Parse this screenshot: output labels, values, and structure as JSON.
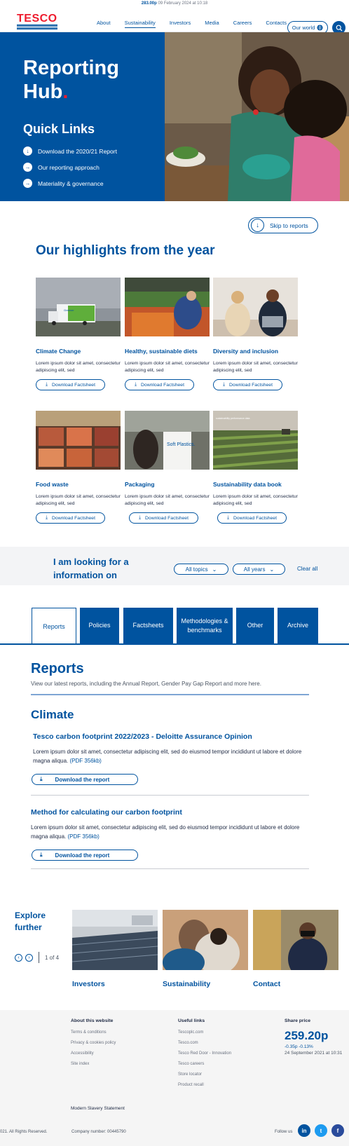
{
  "ticker": {
    "price": "283.00p",
    "date": "09 February 2024 at 10:18"
  },
  "header": {
    "logo": "TESCO",
    "nav": [
      "About",
      "Sustainability",
      "Investors",
      "Media",
      "Careers",
      "Contacts"
    ],
    "active_nav": "Sustainability",
    "our_world": "Our world"
  },
  "hero": {
    "title_line1": "Reporting",
    "title_line2": "Hub",
    "quick_links_title": "Quick Links",
    "quick_links": [
      "Download the 2020/21 Report",
      "Our reporting approach",
      "Materiality & governance"
    ]
  },
  "skip_label": "Skip to reports",
  "highlights": {
    "title": "Our highlights from the year",
    "cards": [
      {
        "title": "Climate Change",
        "desc": "Lorem ipsum dolor sit amet, consectetur adipiscing elit, sed",
        "button": "Download Factsheet"
      },
      {
        "title": "Healthy, sustainable diets",
        "desc": "Lorem ipsum dolor sit amet, consectetur adipiscing elit, sed",
        "button": "Download Factsheet"
      },
      {
        "title": "Diversity and inclusion",
        "desc": "Lorem ipsum dolor sit amet, consectetur adipiscing elit, sed",
        "button": "Download Factsheet"
      },
      {
        "title": "Food waste",
        "desc": "Lorem ipsum dolor sit amet, consectetur adipiscing elit, sed",
        "button": "Download Factsheet"
      },
      {
        "title": "Packaging",
        "desc": "Lorem ipsum dolor sit amet, consectetur adipiscing elit, sed",
        "button": "Download Factsheet"
      },
      {
        "title": "Sustainability data book",
        "desc": "Lorem ipsum dolor sit amet, consectetur adipiscing elit, sed",
        "button": "Download Factsheet"
      }
    ],
    "image_texts": {
      "truck": "Greener",
      "bag": "Soft Plastics.",
      "field": "sustainability performance data"
    }
  },
  "filter": {
    "label": "I am looking for a information on",
    "topics": "All topics",
    "years": "All years",
    "clear": "Clear all"
  },
  "tabs": [
    "Reports",
    "Policies",
    "Factsheets",
    "Methodologies & benchmarks",
    "Other",
    "Archive"
  ],
  "reports": {
    "title": "Reports",
    "subtitle": "View our latest reports, including the Annual Report, Gender Pay Gap Report and more here.",
    "category": "Climate",
    "items": [
      {
        "title": "Tesco carbon footprint 2022/2023 - Deloitte Assurance Opinion",
        "desc": "Lorem ipsum dolor sit amet, consectetur adipiscing elit, sed do eiusmod tempor incididunt ut labore et dolore magna aliqua.",
        "pdf": "(PDF 356kb)",
        "button": "Download the report"
      },
      {
        "title": "Method for calculating our carbon footprint",
        "desc": "Lorem ipsum dolor sit amet, consectetur adipiscing elit, sed do eiusmod tempor incididunt ut labore et dolore magna aliqua.",
        "pdf": "(PDF 356kb)",
        "button": "Download the report"
      }
    ]
  },
  "explore": {
    "title_line1": "Explore",
    "title_line2": "further",
    "pager": "1 of 4",
    "cards": [
      "Investors",
      "Sustainability",
      "Contact"
    ]
  },
  "footer": {
    "about_title": "About this website",
    "about_links": [
      "Terms & conditions",
      "Privacy & cookies policy",
      "Accessibility",
      "Site index"
    ],
    "useful_title": "Useful links",
    "useful_links": [
      "Tescoplc.com",
      "Tesco.com",
      "Tesco Red Door - Innovation",
      "Tesco careers",
      "Store locator",
      "Product recall"
    ],
    "share_title": "Share price",
    "share_price": "259.20p",
    "share_change": "-0.35p -0.13%",
    "share_date": "24 September 2021 at 10:31",
    "modern_slavery": "Modern Slavery Statement",
    "rights": "021. All Rights Reserved.",
    "company_number": "Company number: 00445790",
    "follow_us": "Follow us",
    "social": [
      "in",
      "t",
      "f"
    ]
  },
  "colors": {
    "brand_blue": "#00539f",
    "brand_red": "#ee1c2e"
  }
}
